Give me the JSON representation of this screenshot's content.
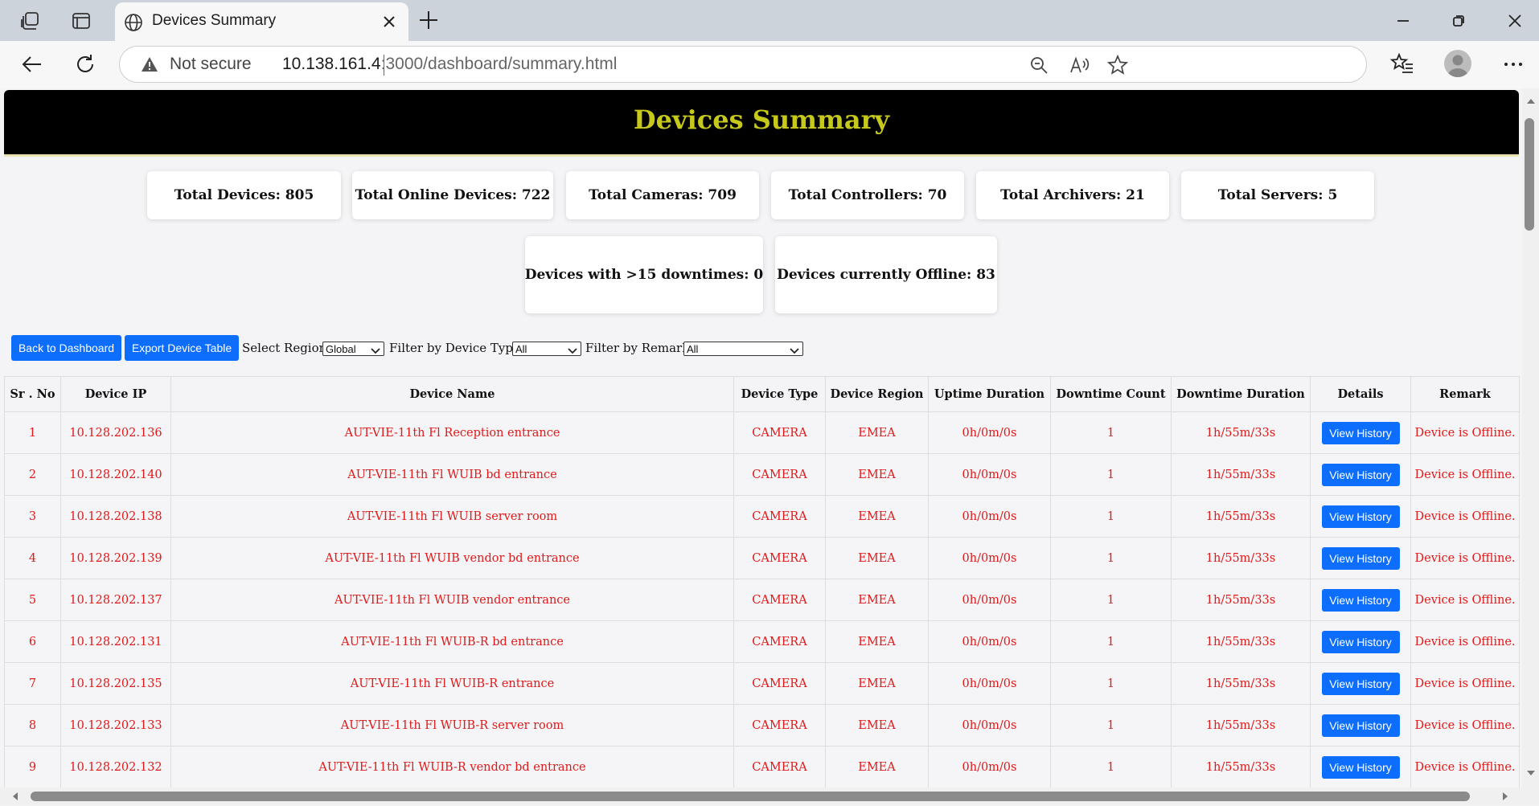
{
  "browser": {
    "tab_title": "Devices Summary",
    "not_secure": "Not secure",
    "url_host": "10.138.161.4",
    "url_path": ":3000/dashboard/summary.html"
  },
  "page": {
    "title": "Devices Summary",
    "stats": {
      "total_devices": "Total Devices: 805",
      "online_devices": "Total Online Devices: 722",
      "cameras": "Total Cameras: 709",
      "controllers": "Total Controllers: 70",
      "archivers": "Total Archivers: 21",
      "servers": "Total Servers: 5",
      "downtimes": "Devices with >15 downtimes: 0",
      "offline": "Devices currently Offline: 83"
    },
    "controls": {
      "back_label": "Back to Dashboard",
      "export_label": "Export Device Table",
      "region_label": "Select Region:",
      "region_value": "Global",
      "type_label": "Filter by Device Type:",
      "type_value": "All",
      "remark_label": "Filter by Remark:",
      "remark_value": "All"
    },
    "table": {
      "headers": [
        "Sr . No",
        "Device IP",
        "Device Name",
        "Device Type",
        "Device Region",
        "Uptime Duration",
        "Downtime Count",
        "Downtime Duration",
        "Details",
        "Remark"
      ],
      "view_label": "View History",
      "rows": [
        [
          "1",
          "10.128.202.136",
          "AUT-VIE-11th Fl Reception entrance",
          "CAMERA",
          "EMEA",
          "0h/0m/0s",
          "1",
          "1h/55m/33s",
          "Device is Offline."
        ],
        [
          "2",
          "10.128.202.140",
          "AUT-VIE-11th Fl WUIB bd entrance",
          "CAMERA",
          "EMEA",
          "0h/0m/0s",
          "1",
          "1h/55m/33s",
          "Device is Offline."
        ],
        [
          "3",
          "10.128.202.138",
          "AUT-VIE-11th Fl WUIB server room",
          "CAMERA",
          "EMEA",
          "0h/0m/0s",
          "1",
          "1h/55m/33s",
          "Device is Offline."
        ],
        [
          "4",
          "10.128.202.139",
          "AUT-VIE-11th Fl WUIB vendor bd entrance",
          "CAMERA",
          "EMEA",
          "0h/0m/0s",
          "1",
          "1h/55m/33s",
          "Device is Offline."
        ],
        [
          "5",
          "10.128.202.137",
          "AUT-VIE-11th Fl WUIB vendor entrance",
          "CAMERA",
          "EMEA",
          "0h/0m/0s",
          "1",
          "1h/55m/33s",
          "Device is Offline."
        ],
        [
          "6",
          "10.128.202.131",
          "AUT-VIE-11th Fl WUIB-R bd entrance",
          "CAMERA",
          "EMEA",
          "0h/0m/0s",
          "1",
          "1h/55m/33s",
          "Device is Offline."
        ],
        [
          "7",
          "10.128.202.135",
          "AUT-VIE-11th Fl WUIB-R entrance",
          "CAMERA",
          "EMEA",
          "0h/0m/0s",
          "1",
          "1h/55m/33s",
          "Device is Offline."
        ],
        [
          "8",
          "10.128.202.133",
          "AUT-VIE-11th Fl WUIB-R server room",
          "CAMERA",
          "EMEA",
          "0h/0m/0s",
          "1",
          "1h/55m/33s",
          "Device is Offline."
        ],
        [
          "9",
          "10.128.202.132",
          "AUT-VIE-11th Fl WUIB-R vendor bd entrance",
          "CAMERA",
          "EMEA",
          "0h/0m/0s",
          "1",
          "1h/55m/33s",
          "Device is Offline."
        ]
      ]
    }
  }
}
